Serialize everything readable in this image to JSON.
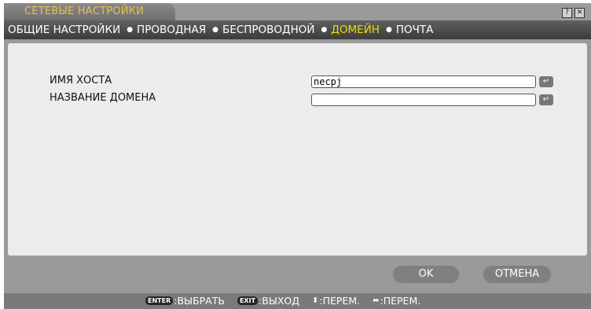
{
  "window": {
    "title": "СЕТЕВЫЕ НАСТРОЙКИ",
    "help_icon": "?",
    "close_icon": "✕"
  },
  "tabs": [
    {
      "label": "ОБЩИЕ НАСТРОЙКИ",
      "active": false
    },
    {
      "label": "ПРОВОДНАЯ",
      "active": false
    },
    {
      "label": "БЕСПРОВОДНОЙ",
      "active": false
    },
    {
      "label": "ДОМЕЙН",
      "active": true
    },
    {
      "label": "ПОЧТА",
      "active": false
    }
  ],
  "tab_separator": "●",
  "form": {
    "host_name_label": "ИМЯ ХОСТА",
    "host_name_value": "necpj",
    "domain_name_label": "НАЗВАНИЕ ДОМЕНА",
    "domain_name_value": "",
    "enter_symbol": "↵"
  },
  "buttons": {
    "ok": "OK",
    "cancel": "ОТМЕНА"
  },
  "footer": {
    "enter_key": "ENTER",
    "enter_hint": ":ВЫБРАТЬ",
    "exit_key": "EXIT",
    "exit_hint": ":ВЫХОД",
    "updown_arrow": "⬍",
    "updown_hint": ":ПЕРЕМ.",
    "leftright_arrow": "⬌",
    "leftright_hint": ":ПЕРЕМ."
  },
  "colors": {
    "title_text": "#e6c04a",
    "active_tab": "#f0dd00",
    "panel_bg": "#ececec",
    "frame_bg": "#9a9a9a"
  }
}
